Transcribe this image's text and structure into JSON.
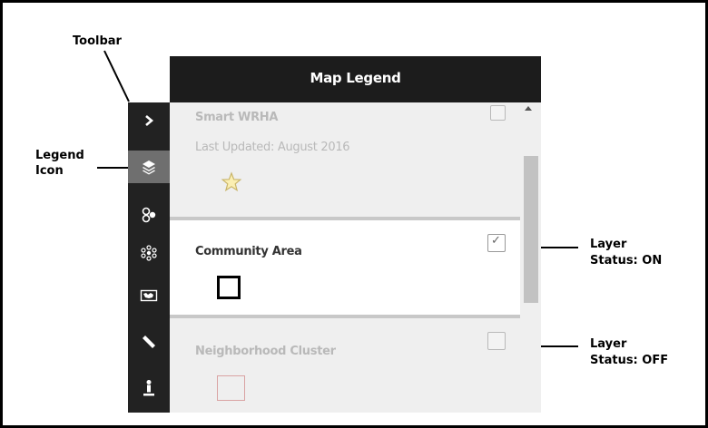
{
  "annotations": {
    "toolbar": "Toolbar",
    "legend_icon_line1": "Legend",
    "legend_icon_line2": "Icon",
    "layer_on_line1": "Layer",
    "layer_on_line2": "Status: ON",
    "layer_off_line1": "Layer",
    "layer_off_line2": "Status: OFF"
  },
  "toolbar": {
    "items": [
      {
        "icon": "chevron-right-icon"
      },
      {
        "icon": "layers-icon",
        "active": true
      },
      {
        "icon": "cluster-icon"
      },
      {
        "icon": "network-icon"
      },
      {
        "icon": "map-icon"
      },
      {
        "icon": "ruler-icon"
      },
      {
        "icon": "location-person-icon"
      }
    ]
  },
  "legend": {
    "title": "Map Legend",
    "items": [
      {
        "title": "Smart WRHA",
        "subtitle": "Last Updated: August 2016",
        "symbol": "star-icon",
        "checked": false
      },
      {
        "title": "Community Area",
        "symbol": "black-square-outline",
        "checked": true,
        "check_mark": "✓"
      },
      {
        "title": "Neighborhood Cluster",
        "symbol": "pink-square-outline",
        "checked": false
      }
    ]
  },
  "colors": {
    "toolbar_bg": "#222222",
    "header_bg": "#1c1c1c",
    "active_tool": "#6f6f6f",
    "star_fill": "#fbefb2",
    "star_stroke": "#c9b56a",
    "cluster_symbol": "#d9a3a3"
  }
}
